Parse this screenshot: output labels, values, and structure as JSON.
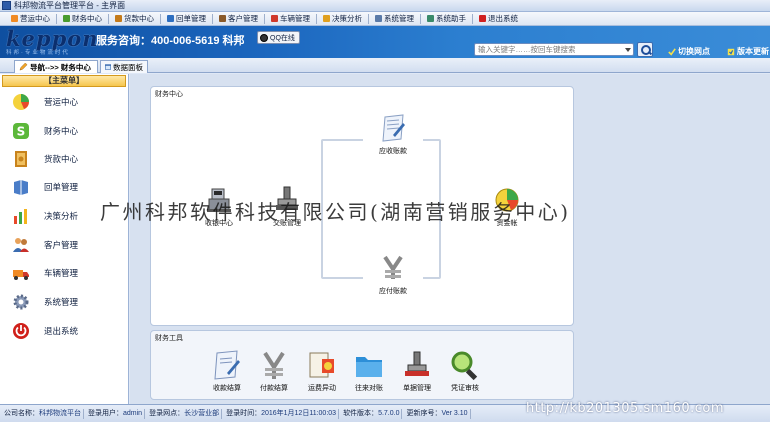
{
  "window": {
    "title": "科邦物流平台管理平台 - 主界面"
  },
  "menubar": {
    "items": [
      {
        "label": "营运中心",
        "color": "#f08a24"
      },
      {
        "label": "财务中心",
        "color": "#4a9c2f"
      },
      {
        "label": "货款中心",
        "color": "#c47a1a"
      },
      {
        "label": "回单管理",
        "color": "#2d6ec0"
      },
      {
        "label": "客户管理",
        "color": "#8a5a2a"
      },
      {
        "label": "车辆管理",
        "color": "#d0392b"
      },
      {
        "label": "决策分析",
        "color": "#e0a020"
      },
      {
        "label": "系统管理",
        "color": "#5a7aa8"
      },
      {
        "label": "系统助手",
        "color": "#3a8a6a"
      },
      {
        "label": "退出系统",
        "color": "#d02020"
      }
    ]
  },
  "banner": {
    "logo": "keppon",
    "slogan": "科邦·专业物流时代",
    "hotline": "服务咨询：400-006-5619 科邦",
    "qq_label": "QQ在线",
    "search_placeholder": "输入关键字……按回车键搜索",
    "switch_branch": "切换网点",
    "version_update": "版本更新"
  },
  "tabs": [
    {
      "label": "导航-->> 财务中心",
      "active": true
    },
    {
      "label": "数据面板",
      "active": false
    }
  ],
  "sidebar": {
    "title": "【主菜单】",
    "items": [
      {
        "label": "营运中心",
        "icon": "pie-chart-icon"
      },
      {
        "label": "财务中心",
        "icon": "finance-s-icon"
      },
      {
        "label": "货款中心",
        "icon": "money-book-icon"
      },
      {
        "label": "回单管理",
        "icon": "book-icon"
      },
      {
        "label": "决策分析",
        "icon": "bar-chart-icon"
      },
      {
        "label": "客户管理",
        "icon": "users-icon"
      },
      {
        "label": "车辆管理",
        "icon": "truck-icon"
      },
      {
        "label": "系统管理",
        "icon": "gear-icon"
      },
      {
        "label": "退出系统",
        "icon": "power-icon"
      }
    ]
  },
  "finance_center": {
    "title": "财务中心",
    "nodes": {
      "receivable": "应收账款",
      "collection": "收银中心",
      "handover": "交账管理",
      "fund": "资金帐",
      "payable": "应付账款"
    }
  },
  "finance_tools": {
    "title": "财务工具",
    "items": [
      {
        "label": "收款结算",
        "icon": "document-icon"
      },
      {
        "label": "付款结算",
        "icon": "yen-icon"
      },
      {
        "label": "运费异动",
        "icon": "freight-change-icon"
      },
      {
        "label": "往来对账",
        "icon": "folder-icon"
      },
      {
        "label": "单据管理",
        "icon": "stamp-icon"
      },
      {
        "label": "凭证审核",
        "icon": "magnifier-icon"
      }
    ]
  },
  "watermark": "广州科邦软件科技有限公司(湖南营销服务中心)",
  "url_watermark": "http://kb201305.sm160.com",
  "statusbar": {
    "company_label": "公司名称：",
    "company": "科邦物流平台",
    "user_label": "登录用户：",
    "user": "admin",
    "branch_label": "登录网点：",
    "branch": "长沙营业部",
    "time_label": "登录时间：",
    "time": "2016年1月12日11:00:03",
    "version_label": "软件版本：",
    "version": "5.7.0.0",
    "serial_label": "更新序号：",
    "serial": "Ver 3.10"
  }
}
